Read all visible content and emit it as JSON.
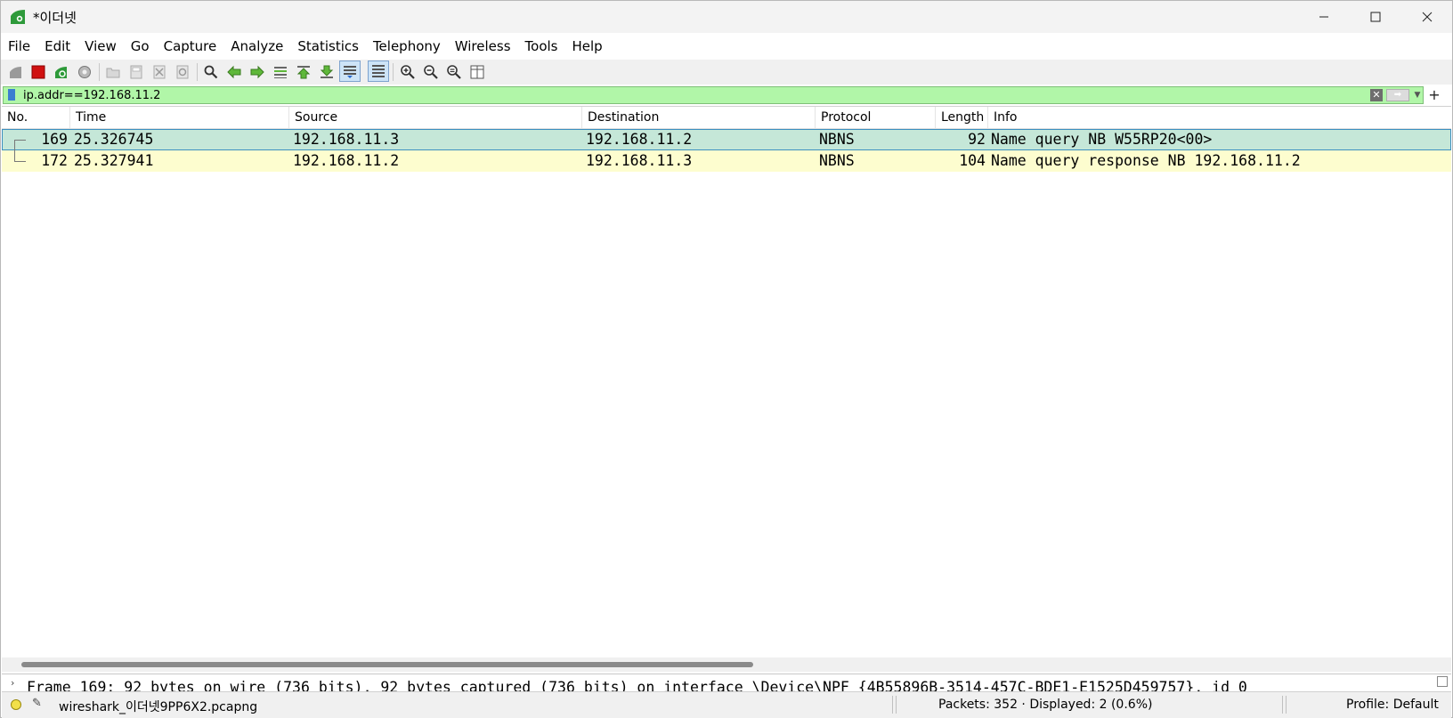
{
  "window": {
    "title": "*이더넷"
  },
  "menu": [
    "File",
    "Edit",
    "View",
    "Go",
    "Capture",
    "Analyze",
    "Statistics",
    "Telephony",
    "Wireless",
    "Tools",
    "Help"
  ],
  "filter": {
    "value": "ip.addr==192.168.11.2",
    "bg_color": "#b1f6a8"
  },
  "columns": [
    "No.",
    "Time",
    "Source",
    "Destination",
    "Protocol",
    "Length",
    "Info"
  ],
  "packets": [
    {
      "no": "169",
      "time": "25.326745",
      "source": "192.168.11.3",
      "destination": "192.168.11.2",
      "protocol": "NBNS",
      "length": "92",
      "info": "Name query NB W55RP20<00>"
    },
    {
      "no": "172",
      "time": "25.327941",
      "source": "192.168.11.2",
      "destination": "192.168.11.3",
      "protocol": "NBNS",
      "length": "104",
      "info": "Name query response NB 192.168.11.2"
    }
  ],
  "details": {
    "line": "Frame 169: 92 bytes on wire (736 bits), 92 bytes captured (736 bits) on interface \\Device\\NPF_{4B55896B-3514-457C-BDE1-E1525D459757}, id 0"
  },
  "status": {
    "file": "wireshark_이더넷9PP6X2.pcapng",
    "packets": "Packets: 352 · Displayed: 2 (0.6%)",
    "profile": "Profile: Default"
  },
  "toolbar_icons": [
    "shark-fin-start-icon",
    "stop-capture-icon",
    "restart-capture-icon",
    "capture-options-icon",
    "open-file-icon",
    "save-file-icon",
    "close-file-icon",
    "reload-file-icon",
    "find-packet-icon",
    "go-back-icon",
    "go-forward-icon",
    "go-to-packet-icon",
    "go-first-icon",
    "go-last-icon",
    "auto-scroll-icon",
    "colorize-icon",
    "zoom-in-icon",
    "zoom-out-icon",
    "zoom-normal-icon",
    "resize-columns-icon"
  ]
}
